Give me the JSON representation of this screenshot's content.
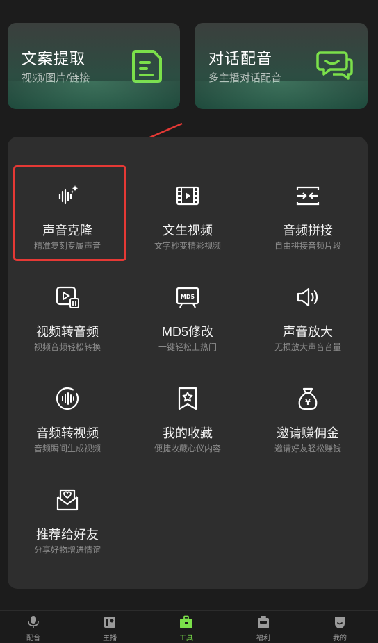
{
  "top_cards": [
    {
      "title": "文案提取",
      "subtitle": "视频/图片/链接",
      "icon": "document-extract-icon"
    },
    {
      "title": "对话配音",
      "subtitle": "多主播对话配音",
      "icon": "chat-bubbles-icon"
    }
  ],
  "tools": [
    {
      "title": "声音克隆",
      "subtitle": "精准复刻专属声音",
      "icon": "voice-clone-icon"
    },
    {
      "title": "文生视频",
      "subtitle": "文字秒变精彩视频",
      "icon": "film-icon"
    },
    {
      "title": "音频拼接",
      "subtitle": "自由拼接音频片段",
      "icon": "merge-icon"
    },
    {
      "title": "视频转音频",
      "subtitle": "视频音频轻松转换",
      "icon": "video-to-audio-icon"
    },
    {
      "title": "MD5修改",
      "subtitle": "一键轻松上热门",
      "icon": "md5-icon"
    },
    {
      "title": "声音放大",
      "subtitle": "无损放大声音音量",
      "icon": "speaker-icon"
    },
    {
      "title": "音频转视频",
      "subtitle": "音频瞬间生成视频",
      "icon": "audio-to-video-icon"
    },
    {
      "title": "我的收藏",
      "subtitle": "便捷收藏心仪内容",
      "icon": "bookmark-star-icon"
    },
    {
      "title": "邀请赚佣金",
      "subtitle": "邀请好友轻松赚钱",
      "icon": "money-bag-icon"
    },
    {
      "title": "推荐给好友",
      "subtitle": "分享好物增进情谊",
      "icon": "heart-envelope-icon"
    }
  ],
  "tabs": [
    {
      "label": "配音",
      "icon": "microphone-icon"
    },
    {
      "label": "主播",
      "icon": "anchor-icon"
    },
    {
      "label": "工具",
      "icon": "toolbox-icon",
      "active": true
    },
    {
      "label": "福利",
      "icon": "gift-icon"
    },
    {
      "label": "我的",
      "icon": "profile-icon"
    }
  ],
  "colors": {
    "accent": "#7be04a",
    "highlight": "#e53935",
    "panel": "#2e2e2e",
    "background": "#1c1c1c"
  }
}
